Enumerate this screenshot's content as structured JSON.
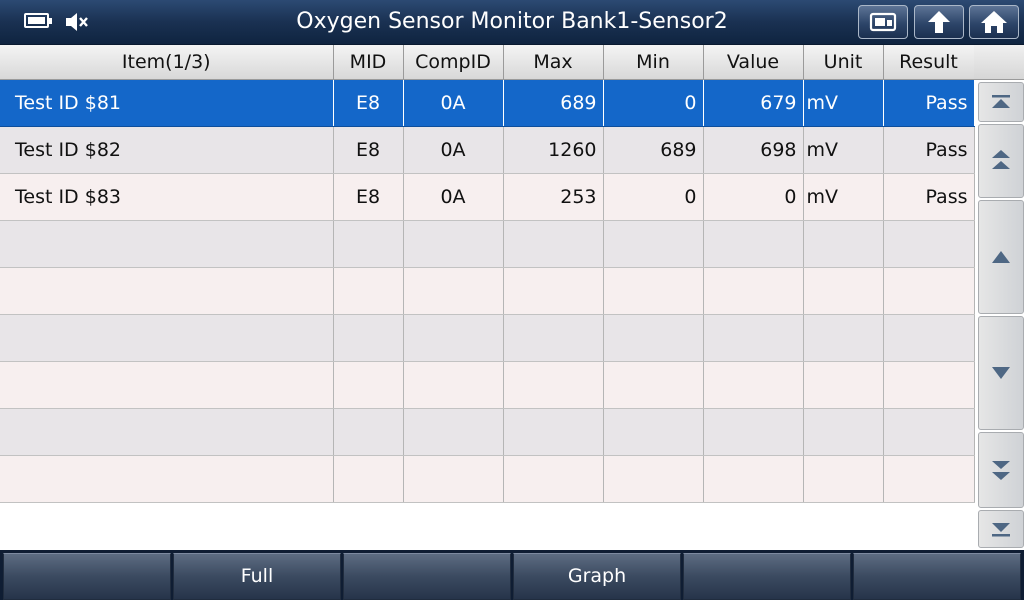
{
  "header": {
    "title": "Oxygen Sensor Monitor Bank1-Sensor2",
    "status": {
      "battery_icon": "battery-charging-icon",
      "mute_icon": "speaker-muted-icon"
    },
    "buttons": [
      "print-screen-icon",
      "back-arrow-icon",
      "home-icon"
    ]
  },
  "table": {
    "columns": [
      "Item(1/3)",
      "MID",
      "CompID",
      "Max",
      "Min",
      "Value",
      "Unit",
      "Result"
    ],
    "rows": [
      {
        "item": "Test ID $81",
        "mid": "E8",
        "compid": "0A",
        "max": "689",
        "min": "0",
        "value": "679",
        "unit": "mV",
        "result": "Pass"
      },
      {
        "item": "Test ID $82",
        "mid": "E8",
        "compid": "0A",
        "max": "1260",
        "min": "689",
        "value": "698",
        "unit": "mV",
        "result": "Pass"
      },
      {
        "item": "Test ID $83",
        "mid": "E8",
        "compid": "0A",
        "max": "253",
        "min": "0",
        "value": "0",
        "unit": "mV",
        "result": "Pass"
      }
    ],
    "selected_row": 0
  },
  "scroll": [
    "scroll-top-icon",
    "page-up-icon",
    "line-up-icon",
    "line-down-icon",
    "page-down-icon",
    "scroll-bottom-icon"
  ],
  "footer": {
    "buttons": [
      "",
      "Full",
      "",
      "Graph",
      "",
      ""
    ]
  },
  "colors": {
    "selected": "#1467c9",
    "titlebar": "#1a3152"
  }
}
